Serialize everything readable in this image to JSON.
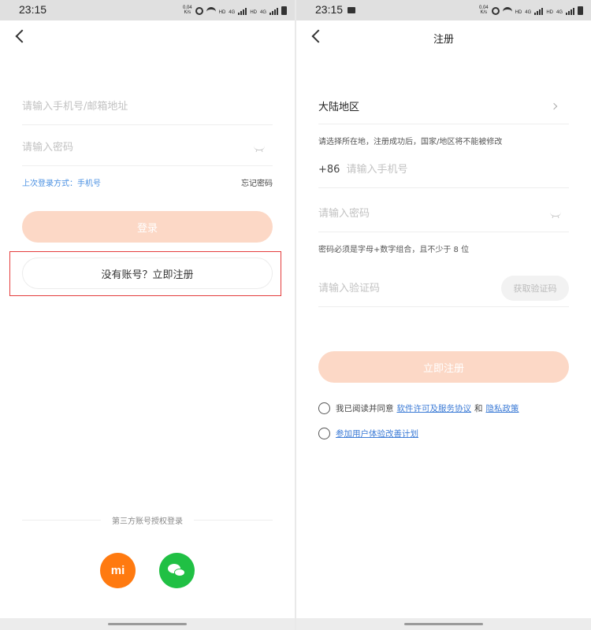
{
  "status_bar": {
    "time": "23:15",
    "speed_value": "0.04",
    "speed_unit": "K/s",
    "hd": "HD",
    "net": "4G"
  },
  "login": {
    "account_placeholder": "请输入手机号/邮箱地址",
    "password_placeholder": "请输入密码",
    "last_login_label": "上次登录方式：",
    "last_login_value": "手机号",
    "forgot_password": "忘记密码",
    "login_button": "登录",
    "register_button": "没有账号？立即注册",
    "third_party_label": "第三方账号授权登录",
    "mi_label": "mi"
  },
  "register": {
    "title": "注册",
    "region": "大陆地区",
    "region_hint": "请选择所在地，注册成功后，国家/地区将不能被修改",
    "country_code": "+86",
    "phone_placeholder": "请输入手机号",
    "password_placeholder": "请输入密码",
    "password_hint": "密码必须是字母+数字组合，且不少于 8 位",
    "code_placeholder": "请输入验证码",
    "get_code_button": "获取验证码",
    "register_button": "立即注册",
    "agree_prefix": "我已阅读并同意",
    "license_link": "软件许可及服务协议",
    "and_text": "和",
    "privacy_link": "隐私政策",
    "ux_program_link": "参加用户体验改善计划"
  },
  "colors": {
    "primary_disabled": "#fcd8c6",
    "link": "#4a90e2",
    "highlight": "#e43d3d",
    "mi_orange": "#ff7a10",
    "wechat_green": "#20c044"
  }
}
